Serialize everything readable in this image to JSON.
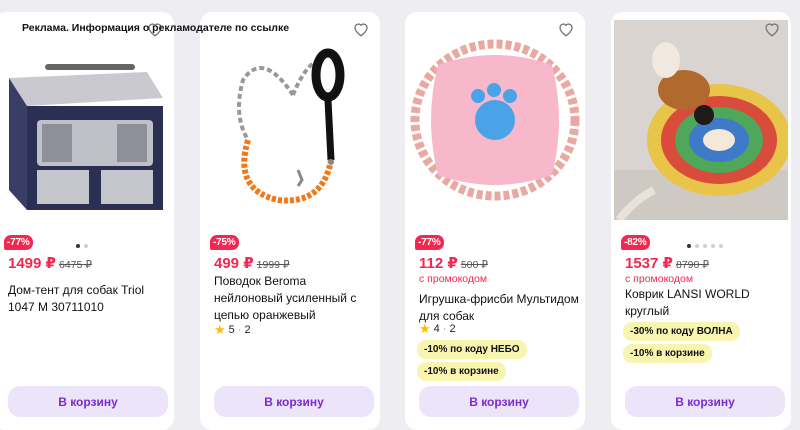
{
  "ad_note": "Реклама. Информация о рекламодателе по ссылке",
  "products": [
    {
      "discount": "-77%",
      "price": "1499 ₽",
      "old_price": "6475 ₽",
      "title": "Дом-тент для собак Triol 1047 M 30711010",
      "cart_label": "В корзину"
    },
    {
      "discount": "-75%",
      "price": "499 ₽",
      "old_price": "1999 ₽",
      "title": "Поводок Beroma нейлоновый усиленный с цепью оранжевый",
      "rating": "5",
      "reviews": "2",
      "cart_label": "В корзину"
    },
    {
      "discount": "-77%",
      "price": "112 ₽",
      "old_price": "500 ₽",
      "promo_label": "с промокодом",
      "title": "Игрушка-фрисби Мультидом для собак",
      "rating": "4",
      "reviews": "2",
      "tags": [
        "-10% по коду НЕБО",
        "-10% в корзине"
      ],
      "cart_label": "В корзину"
    },
    {
      "discount": "-82%",
      "price": "1537 ₽",
      "old_price": "8790 ₽",
      "promo_label": "с промокодом",
      "title": "Коврик LANSI WORLD круглый",
      "tags": [
        "-30% по коду ВОЛНА",
        "-10% в корзине"
      ],
      "cart_label": "В корзину"
    }
  ],
  "colors": {
    "accent": "#f5264f",
    "cart_bg": "#ece4f8",
    "cart_text": "#7b2bd3",
    "tag_bg": "#f7f5b0"
  },
  "icons": {
    "favorite": "heart-outline-icon",
    "rating": "star-icon"
  }
}
